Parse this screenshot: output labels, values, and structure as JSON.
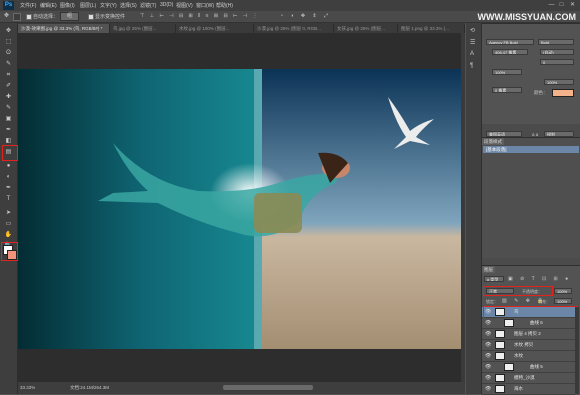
{
  "app": {
    "logo": "Ps"
  },
  "menu": [
    "文件(F)",
    "编辑(E)",
    "图像(I)",
    "图层(L)",
    "文字(Y)",
    "选择(S)",
    "滤镜(T)",
    "3D(D)",
    "视图(V)",
    "窗口(W)",
    "帮助(H)"
  ],
  "window_buttons": [
    "—",
    "□",
    "✕"
  ],
  "options_bar": {
    "auto_select_label": "自动选择：",
    "auto_select_value": "组",
    "show_transform_label": "显示变换控件"
  },
  "watermark": "WWW.MISSYUAN.COM",
  "tabs": [
    {
      "label": "沙漠-效果图.jpg @ 33.3% (鸟, RGB/8#) *",
      "active": true
    },
    {
      "label": "鸟.jpg @ 25% (图层...",
      "active": false
    },
    {
      "label": "水纹.jpg @ 100% (图层...",
      "active": false
    },
    {
      "label": "沙漠.jpg @ 25% (图层 0, RGB...",
      "active": false
    },
    {
      "label": "女孩.jpg @ 25% (图层...",
      "active": false
    },
    {
      "label": "图层 1.png @ 33.3% (...",
      "active": false
    }
  ],
  "toolbar": {
    "tools": [
      "move-tool",
      "marquee-tool",
      "lasso-tool",
      "quick-select-tool",
      "crop-tool",
      "eyedropper-tool",
      "healing-tool",
      "brush-tool",
      "stamp-tool",
      "history-brush-tool",
      "eraser-tool",
      "gradient-tool",
      "blur-tool",
      "dodge-tool",
      "pen-tool",
      "type-tool",
      "path-select-tool",
      "shape-tool",
      "hand-tool",
      "zoom-tool"
    ],
    "glyphs": [
      "✥",
      "⬚",
      "ʘ",
      "✎",
      "⌗",
      "✐",
      "✚",
      "✎",
      "▣",
      "✒",
      "◧",
      "▤",
      "●",
      "◐",
      "✒",
      "T",
      "➤",
      "▭",
      "✋",
      "🔍"
    ]
  },
  "character_panel": {
    "font_family": "Agency FB Bold",
    "font_style": "Bold",
    "font_size": "406.47 像素",
    "leading": "(自动)",
    "tracking": "0",
    "scale_v": "100%",
    "scale_h": "100%",
    "baseline": "0 像素",
    "color_label": "颜色：",
    "language": "美国英语",
    "aa_label": "锐利",
    "aa_value": "a a"
  },
  "swatch_color": "#f4b28c",
  "history_panel": {
    "tab": "段落样式",
    "item": "[基本段落]"
  },
  "layers_panel": {
    "tab": "图层",
    "filter": "ρ 类型",
    "blend_mode": "正常",
    "opacity_label": "不透明度：",
    "opacity": "100%",
    "lock_label": "锁定：",
    "fill_label": "填充：",
    "fill": "100%",
    "layers": [
      {
        "name": "鸟",
        "selected": true
      },
      {
        "name": "曲线 6",
        "selected": false
      },
      {
        "name": "图层 4 拷贝 2",
        "selected": false
      },
      {
        "name": "水纹 拷贝",
        "selected": false
      },
      {
        "name": "水纹",
        "selected": false
      },
      {
        "name": "曲线 5",
        "selected": false
      },
      {
        "name": "模特_沙漠",
        "selected": false
      },
      {
        "name": "海水",
        "selected": false
      }
    ]
  },
  "status": {
    "zoom": "33.33%",
    "doc_info": "文档:24.1M/264.3M"
  },
  "colors": {
    "accent_red": "#e0241c",
    "fg_color": "#ffffff",
    "bg_color": "#f0937a"
  }
}
